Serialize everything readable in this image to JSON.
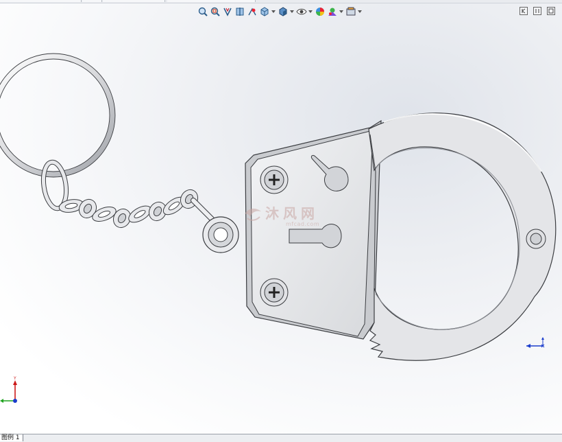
{
  "window": {
    "sheet_tab_label": "图例 1"
  },
  "heads_up_toolbar": {
    "tools": [
      {
        "name": "zoom-to-fit-icon"
      },
      {
        "name": "zoom-to-area-icon"
      },
      {
        "name": "previous-view-icon"
      },
      {
        "name": "section-view-icon"
      },
      {
        "name": "dynamic-annotation-icon"
      },
      {
        "name": "view-orientation-icon"
      },
      {
        "name": "display-style-icon"
      },
      {
        "name": "hide-show-items-icon"
      },
      {
        "name": "edit-appearance-icon"
      },
      {
        "name": "apply-scene-icon"
      },
      {
        "name": "view-settings-icon"
      }
    ]
  },
  "window_controls": [
    {
      "name": "restore-pane-icon"
    },
    {
      "name": "tile-pane-icon"
    },
    {
      "name": "maximize-pane-icon"
    }
  ],
  "watermark": {
    "text": "沐风网",
    "sub": "mfcad.com"
  },
  "triad": {
    "y_label": "Y",
    "x_label": "X"
  },
  "colors": {
    "part_fill": "#e6e7ea",
    "part_edge": "#3a3c40",
    "axis_x": "#cc1a1a",
    "axis_y": "#1fa31f",
    "axis_z": "#1a3ccc",
    "watermark": "#c9a6a3"
  }
}
